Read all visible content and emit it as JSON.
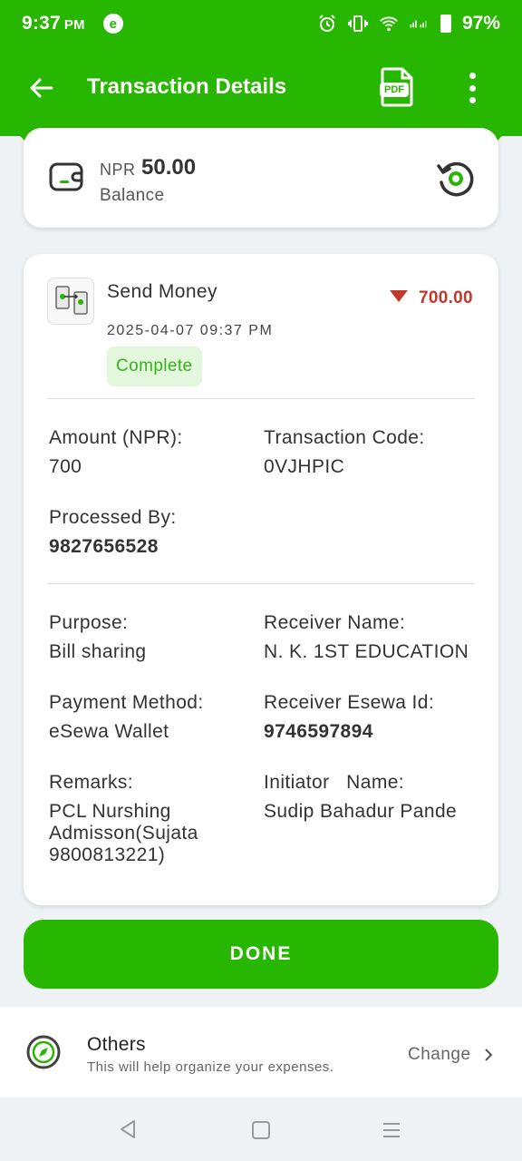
{
  "status_bar": {
    "time": "9:37",
    "time_suffix": "PM",
    "app_icon_letter": "e",
    "battery": "97%"
  },
  "app_bar": {
    "title": "Transaction Details",
    "pdf_icon_label": "PDF"
  },
  "balance": {
    "currency": "NPR",
    "amount": "50.00",
    "label": "Balance"
  },
  "transaction": {
    "service": "Send Money",
    "datetime": "2025-04-07 09:37 PM",
    "status": "Complete",
    "amount": "700.00",
    "fields": {
      "amount_label": "Amount (NPR):",
      "amount_value": "700",
      "code_label": "Transaction Code:",
      "code_value": "0VJHPIC",
      "processed_label": "Processed By:",
      "processed_value": "9827656528",
      "purpose_label": "Purpose:",
      "purpose_value": "Bill sharing",
      "receiver_name_label": "Receiver Name:",
      "receiver_name_value": "N. K. 1ST EDUCATION",
      "payment_method_label": "Payment Method:",
      "payment_method_value": "eSewa Wallet",
      "receiver_id_label": "Receiver Esewa Id:",
      "receiver_id_value": "9746597894",
      "remarks_label": "Remarks:",
      "remarks_value": "PCL Nurshing Admisson(Sujata 9800813221)",
      "initiator_label": "Initiator   Name:",
      "initiator_value": "Sudip Bahadur Pande"
    }
  },
  "done_button": "DONE",
  "category": {
    "title": "Others",
    "subtitle": "This will help organize your expenses.",
    "change_label": "Change"
  },
  "colors": {
    "brand_green": "#28b700",
    "debit_red": "#c0392b",
    "status_green": "#35b31a"
  }
}
